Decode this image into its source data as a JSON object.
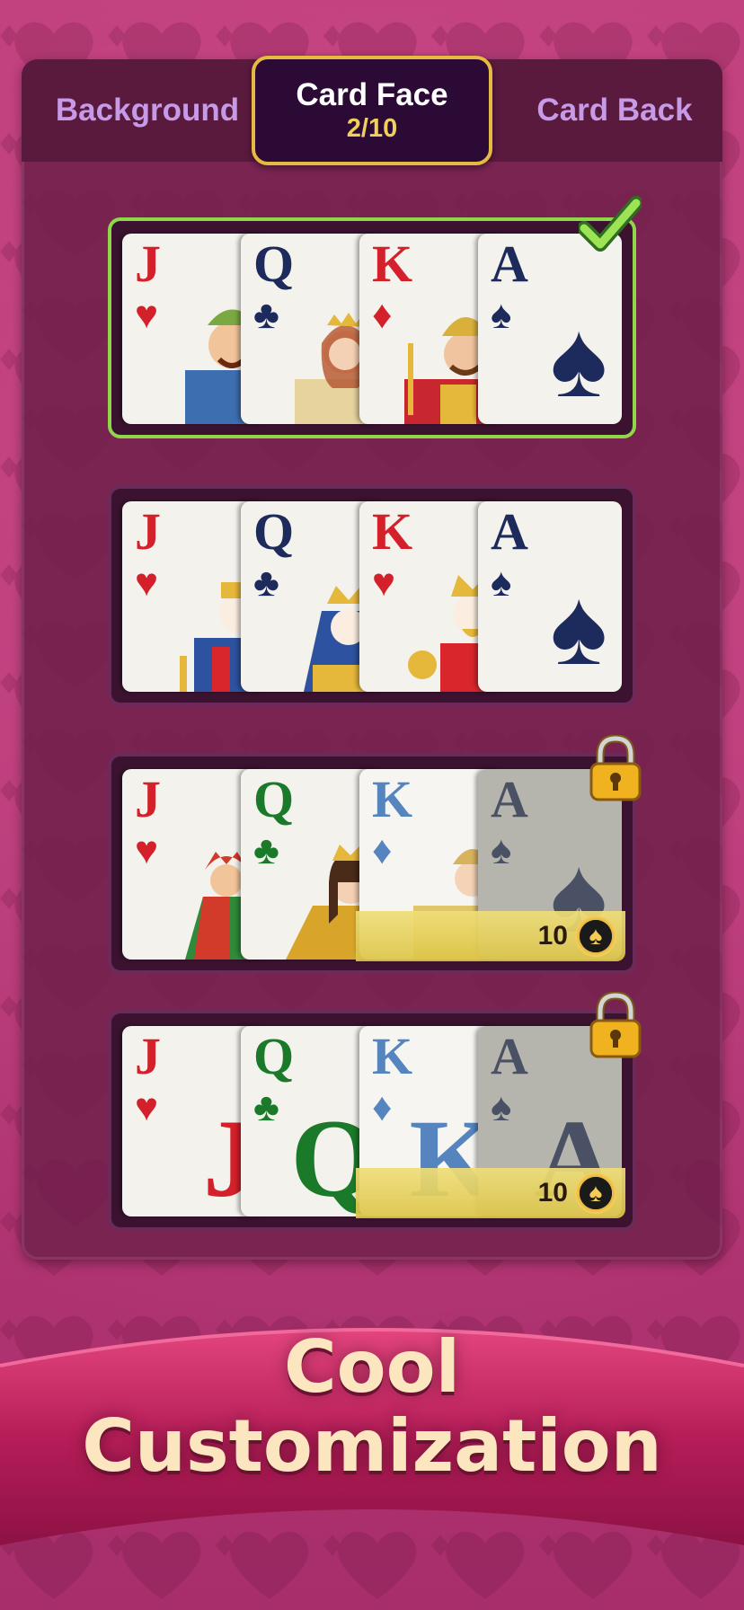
{
  "tabs": {
    "background_label": "Background",
    "card_face_label": "Card Face",
    "card_face_count": "2/10",
    "card_back_label": "Card Back"
  },
  "options": [
    {
      "name": "classic-illustrated",
      "selected": true,
      "locked": false,
      "cards": [
        {
          "rank": "J",
          "suit": "♥"
        },
        {
          "rank": "Q",
          "suit": "♣"
        },
        {
          "rank": "K",
          "suit": "♦"
        },
        {
          "rank": "A",
          "suit": "♠"
        }
      ]
    },
    {
      "name": "traditional",
      "selected": false,
      "locked": false,
      "cards": [
        {
          "rank": "J",
          "suit": "♥"
        },
        {
          "rank": "Q",
          "suit": "♣"
        },
        {
          "rank": "K",
          "suit": "♥"
        },
        {
          "rank": "A",
          "suit": "♠"
        }
      ]
    },
    {
      "name": "medieval",
      "selected": false,
      "locked": true,
      "price": "10",
      "cards": [
        {
          "rank": "J",
          "suit": "♥"
        },
        {
          "rank": "Q",
          "suit": "♣"
        },
        {
          "rank": "K",
          "suit": "♦"
        },
        {
          "rank": "A",
          "suit": "♠"
        }
      ]
    },
    {
      "name": "large-index",
      "selected": false,
      "locked": true,
      "price": "10",
      "cards": [
        {
          "rank": "J",
          "suit": "♥"
        },
        {
          "rank": "Q",
          "suit": "♣"
        },
        {
          "rank": "K",
          "suit": "♦"
        },
        {
          "rank": "A",
          "suit": "♠"
        }
      ]
    }
  ],
  "banner": {
    "line1": "Cool",
    "line2": "Customization"
  },
  "colors": {
    "accent_gold": "#e6b942",
    "selected_green": "#8fd64a",
    "tab_text": "#c79ae8"
  }
}
